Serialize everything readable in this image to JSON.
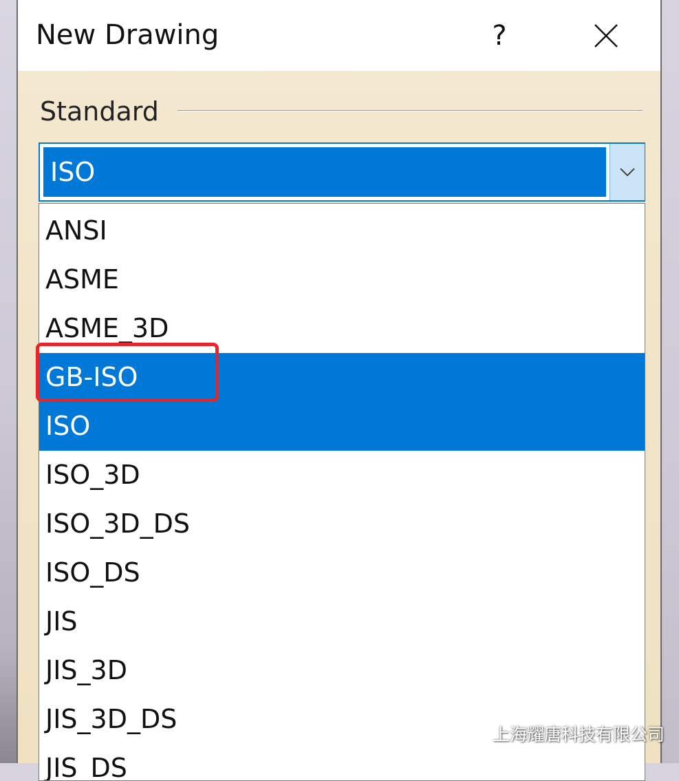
{
  "dialog": {
    "title": "New Drawing",
    "help_label": "?",
    "standard_label": "Standard",
    "selected_value": "ISO"
  },
  "dropdown": {
    "options": [
      "ANSI",
      "ASME",
      "ASME_3D",
      "GB-ISO",
      "ISO",
      "ISO_3D",
      "ISO_3D_DS",
      "ISO_DS",
      "JIS",
      "JIS_3D",
      "JIS_3D_DS",
      "JIS_DS"
    ],
    "highlighted_options": [
      "GB-ISO",
      "ISO"
    ]
  },
  "annotation": {
    "highlighted_option": "GB-ISO",
    "color": "#e8262a"
  },
  "watermark": {
    "text": "上海耀唐科技有限公司"
  },
  "colors": {
    "accent": "#0078d7",
    "dialog_background": "#f1e4c8"
  }
}
